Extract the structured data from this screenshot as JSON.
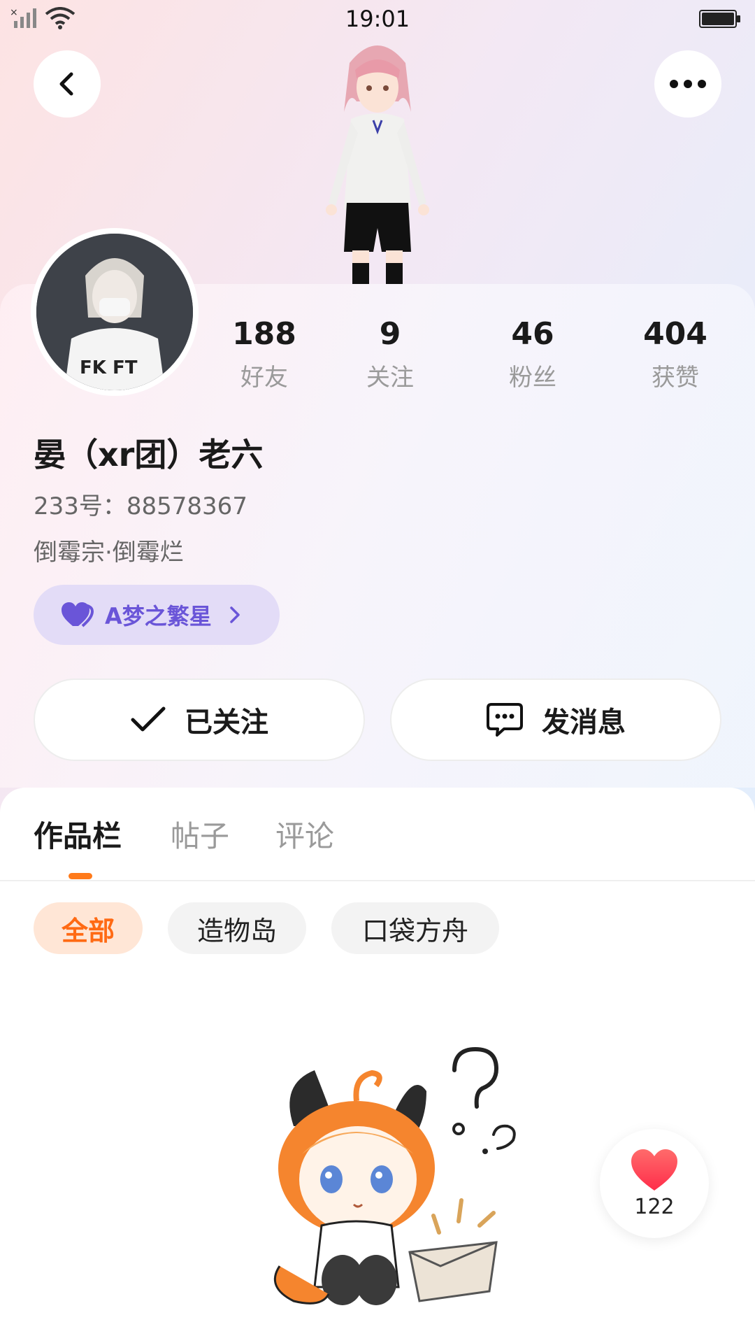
{
  "status_bar": {
    "time": "19:01",
    "icons": [
      "signal-icon",
      "wifi-icon",
      "battery-icon"
    ]
  },
  "header": {
    "back_icon": "chevron-left-icon",
    "more_icon": "more-dots-icon"
  },
  "profile": {
    "name": "晏（xr团）老六",
    "id_line": "233号：88578367",
    "bio": "倒霉宗·倒霉烂",
    "stats": [
      {
        "value": "188",
        "label": "好友"
      },
      {
        "value": "9",
        "label": "关注"
      },
      {
        "value": "46",
        "label": "粉丝"
      },
      {
        "value": "404",
        "label": "获赞"
      }
    ],
    "group": {
      "label": "A梦之繁星",
      "icon": "heart-icon"
    }
  },
  "actions": {
    "follow_label": "已关注",
    "follow_icon": "check-icon",
    "message_label": "发消息",
    "message_icon": "chat-icon"
  },
  "tabs": [
    {
      "label": "作品栏",
      "active": true
    },
    {
      "label": "帖子",
      "active": false
    },
    {
      "label": "评论",
      "active": false
    }
  ],
  "filters": [
    {
      "label": "全部",
      "selected": true
    },
    {
      "label": "造物岛",
      "selected": false
    },
    {
      "label": "口袋方舟",
      "selected": false
    }
  ],
  "like_button": {
    "count": "122",
    "icon": "heart-icon"
  },
  "colors": {
    "accent": "#ff7a1a",
    "group_text": "#6a55d8",
    "group_bg": "#e3dcf7",
    "like_red": "#ff3b4a"
  }
}
